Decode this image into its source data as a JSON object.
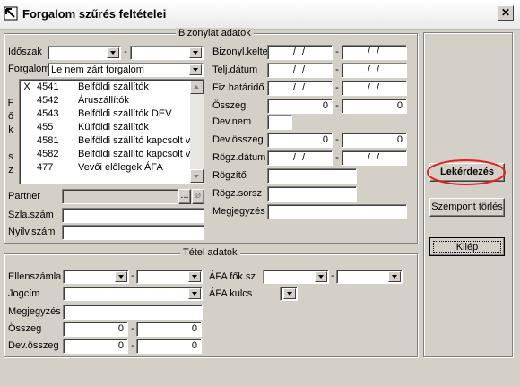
{
  "window": {
    "title": "Forgalom szűrés feltételei",
    "close_glyph": "✕"
  },
  "bizonylat": {
    "group_title": "Bizonylat adatok",
    "idoszak_label": "Időszak",
    "forgalom_label": "Forgalom",
    "forgalom_value": "Le nem zárt forgalom",
    "fokszam_vertical": [
      "F",
      "ő",
      "k",
      "",
      "s",
      "z"
    ],
    "accounts": [
      {
        "mark": "X",
        "code": "4541",
        "name": "Belföldi szállítók"
      },
      {
        "mark": "",
        "code": "4542",
        "name": "Áruszállítók"
      },
      {
        "mark": "",
        "code": "4543",
        "name": "Belföldi szállítók DEV"
      },
      {
        "mark": "",
        "code": "455",
        "name": "Külföldi szállítók"
      },
      {
        "mark": "",
        "code": "4581",
        "name": "Belföldi szállító kapcsolt v"
      },
      {
        "mark": "",
        "code": "4582",
        "name": "Belföldi szállító kapcsolt v"
      },
      {
        "mark": "",
        "code": "477",
        "name": "Vevői előlegek ÁFA"
      }
    ],
    "partner_label": "Partner",
    "partner_btn": "...",
    "partner_btn2": "ø",
    "szlaszam_label": "Szla.szám",
    "nyilvszam_label": "Nyilv.szám",
    "kelte_label": "Bizonyl.kelte",
    "teljdatum_label": "Telj.dátum",
    "fizhatarido_label": "Fiz.határidő",
    "osszeg_label": "Összeg",
    "devnem_label": "Dev.nem",
    "devosszeg_label": "Dev.összeg",
    "rogzdatum_label": "Rögz.dátum",
    "rogzito_label": "Rögzítő",
    "rogzsorsz_label": "Rögz.sorsz",
    "megjegyzes_label": "Megjegyzés",
    "date_placeholder": "/ /",
    "zero": "0",
    "dash": "-"
  },
  "tetel": {
    "group_title": "Tétel adatok",
    "ellenszamla_label": "Ellenszámla",
    "jogcim_label": "Jogcím",
    "megjegyzes_label": "Megjegyzés",
    "osszeg_label": "Összeg",
    "devosszeg_label": "Dev.összeg",
    "afafoksz_label": "ÁFA fők.sz",
    "afakulcs_label": "ÁFA kulcs",
    "zero": "0",
    "dash": "-"
  },
  "actions": {
    "lekerdezes": "Lekérdezés",
    "szempont_torles": "Szempont törlés",
    "kilep": "Kilép"
  },
  "colors": {
    "highlight_circle": "#e02020"
  }
}
